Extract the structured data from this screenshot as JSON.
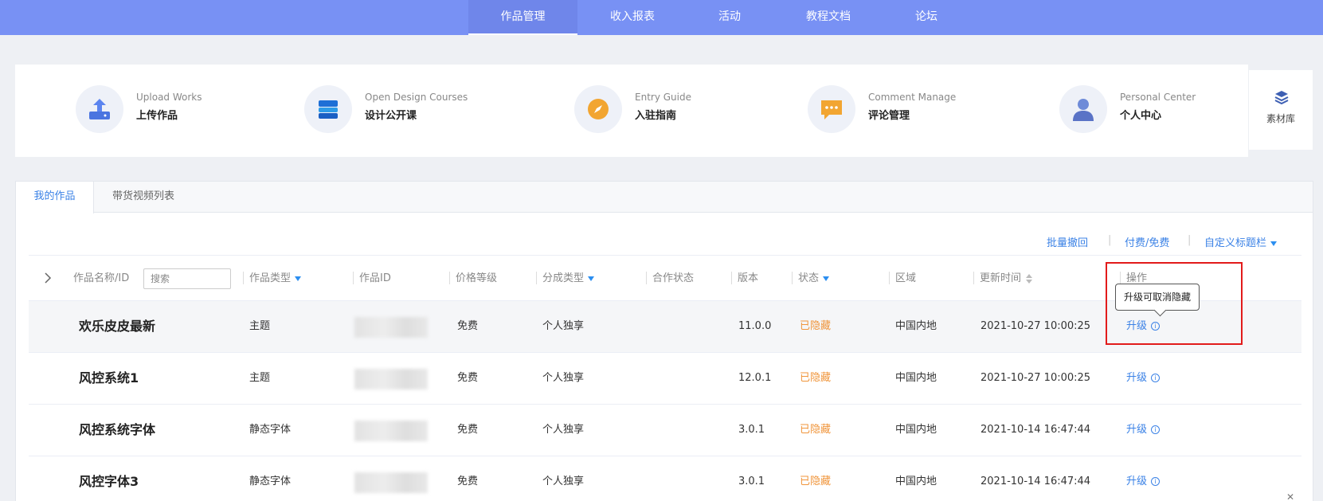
{
  "nav": {
    "items": [
      "作品管理",
      "收入报表",
      "活动",
      "教程文档",
      "论坛"
    ],
    "active": "作品管理"
  },
  "quick": [
    {
      "en": "Upload Works",
      "zh": "上传作品",
      "icon": "upload-icon"
    },
    {
      "en": "Open Design Courses",
      "zh": "设计公开课",
      "icon": "course-book-icon"
    },
    {
      "en": "Entry Guide",
      "zh": "入驻指南",
      "icon": "compass-icon"
    },
    {
      "en": "Comment Manage",
      "zh": "评论管理",
      "icon": "comment-icon"
    },
    {
      "en": "Personal Center",
      "zh": "个人中心",
      "icon": "user-icon"
    }
  ],
  "sidecard": {
    "label": "素材库",
    "icon": "layers-icon"
  },
  "tabs": [
    "我的作品",
    "带货视频列表"
  ],
  "toolbar": {
    "batch_withdraw": "批量撤回",
    "paid_free": "付费/免费",
    "custom_columns": "自定义标题栏",
    "separator": "|"
  },
  "table": {
    "headers": {
      "name": "作品名称/ID",
      "type": "作品类型",
      "id": "作品ID",
      "price": "价格等级",
      "share": "分成类型",
      "coop": "合作状态",
      "version": "版本",
      "status": "状态",
      "region": "区域",
      "updated": "更新时间",
      "action": "操作"
    },
    "search_placeholder": "搜索",
    "rows": [
      {
        "name": "欢乐皮皮最新",
        "type": "主题",
        "price": "免费",
        "share": "个人独享",
        "version": "11.0.0",
        "status": "已隐藏",
        "region": "中国内地",
        "updated": "2021-10-27 10:00:25",
        "action": "升级"
      },
      {
        "name": "风控系统1",
        "type": "主题",
        "price": "免费",
        "share": "个人独享",
        "version": "12.0.1",
        "status": "已隐藏",
        "region": "中国内地",
        "updated": "2021-10-27 10:00:25",
        "action": "升级"
      },
      {
        "name": "风控系统字体",
        "type": "静态字体",
        "price": "免费",
        "share": "个人独享",
        "version": "3.0.1",
        "status": "已隐藏",
        "region": "中国内地",
        "updated": "2021-10-14 16:47:44",
        "action": "升级"
      },
      {
        "name": "风控字体3",
        "type": "静态字体",
        "price": "免费",
        "share": "个人独享",
        "version": "3.0.1",
        "status": "已隐藏",
        "region": "中国内地",
        "updated": "2021-10-14 16:47:44",
        "action": "升级"
      }
    ]
  },
  "tooltip": "升级可取消隐藏",
  "colors": {
    "nav": "#7891f4",
    "accent": "#3b82e6",
    "status_hidden": "#f0953b",
    "highlight_box": "#e21b1b"
  }
}
